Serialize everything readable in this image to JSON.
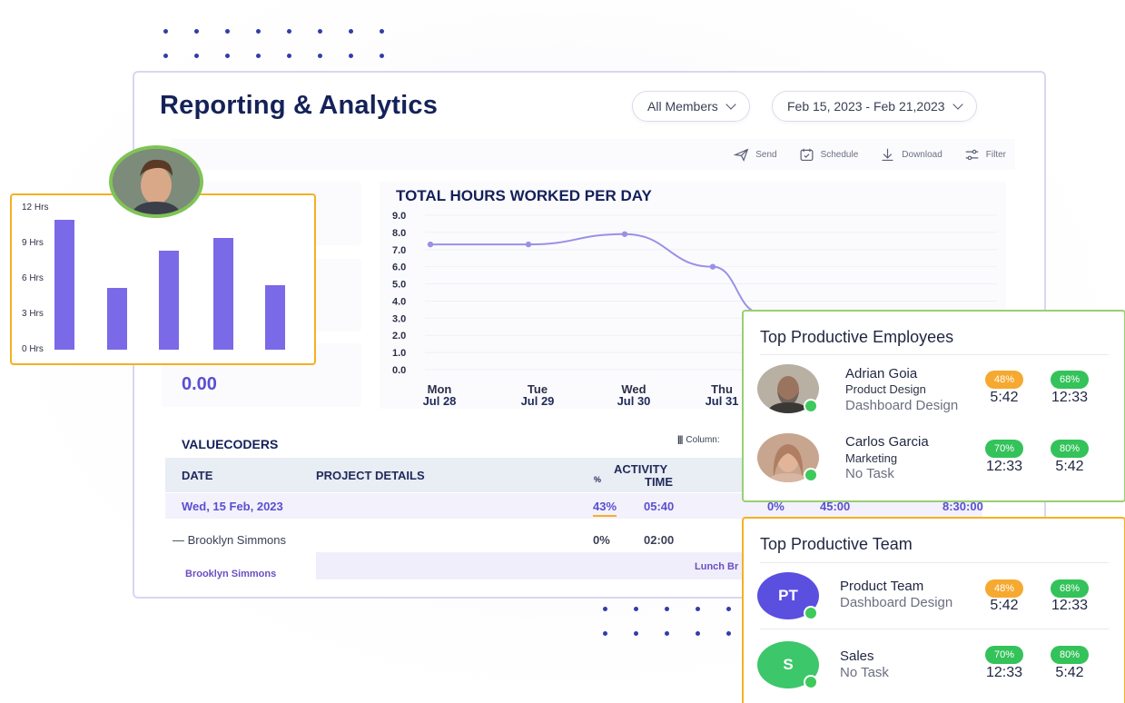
{
  "page": {
    "title": "Reporting & Analytics",
    "members_filter": "All Members",
    "date_range": "Feb 15, 2023 - Feb 21,2023"
  },
  "toolbar": {
    "send": "Send",
    "schedule": "Schedule",
    "download": "Download",
    "filter": "Filter"
  },
  "left_stat": {
    "value": "0.00"
  },
  "chart_data": [
    {
      "type": "line",
      "title": "TOTAL HOURS WORKED PER DAY",
      "categories": [
        [
          "Mon",
          "Jul 28"
        ],
        [
          "Tue",
          "Jul 29"
        ],
        [
          "Wed",
          "Jul 30"
        ],
        [
          "Thu",
          "Jul 31"
        ]
      ],
      "y_ticks": [
        "9.0",
        "8.0",
        "7.0",
        "6.0",
        "5.0",
        "4.0",
        "3.0",
        "2.0",
        "1.0",
        "0.0"
      ],
      "ylim": [
        0,
        9
      ],
      "values": [
        7.3,
        7.3,
        7.9,
        6.0
      ],
      "trailing_value": 3.3,
      "color": "#9a90e8"
    },
    {
      "type": "bar",
      "y_ticks": [
        "12 Hrs",
        "9 Hrs",
        "6 Hrs",
        "3 Hrs",
        "0 Hrs"
      ],
      "ylim": [
        0,
        12
      ],
      "values": [
        11.0,
        5.2,
        8.4,
        9.5,
        5.5
      ],
      "color": "#7a6ae8"
    }
  ],
  "table": {
    "section_title": "VALUECODERS",
    "column_button": "Column:",
    "headers": {
      "date": "DATE",
      "project": "PROJECT DETAILS",
      "activity": "ACTIVITY",
      "percent": "%",
      "time": "TIME"
    },
    "rows": [
      {
        "date": "Wed, 15 Feb, 2023",
        "percent": "43%",
        "time": "05:40",
        "pct2": "0%",
        "t2": "45:00",
        "t3": "8:30:00"
      },
      {
        "name": "— Brooklyn Simmons",
        "percent": "0%",
        "time": "02:00"
      }
    ],
    "sub_label": "Brooklyn Simmons",
    "lunch_label": "Lunch Br"
  },
  "top_employees": {
    "title": "Top Productive Employees",
    "items": [
      {
        "name": "Adrian Goia",
        "role": "Product Design",
        "task": "Dashboard Design",
        "p1": "48%",
        "p2": "68%",
        "t1": "5:42",
        "t2": "12:33"
      },
      {
        "name": "Carlos Garcia",
        "role": "Marketing",
        "task": "No Task",
        "p1": "70%",
        "p2": "80%",
        "t1": "12:33",
        "t2": "5:42"
      }
    ]
  },
  "top_team": {
    "title": "Top Productive Team",
    "items": [
      {
        "initials": "PT",
        "name": "Product Team",
        "task": "Dashboard Design",
        "p1": "48%",
        "p2": "68%",
        "t1": "5:42",
        "t2": "12:33",
        "color": "#5b4fe0"
      },
      {
        "initials": "S",
        "name": "Sales",
        "task": "No Task",
        "p1": "70%",
        "p2": "80%",
        "t1": "12:33",
        "t2": "5:42",
        "color": "#3cc76a"
      }
    ]
  },
  "colors": {
    "accent": "#5a4fd1",
    "orange_border": "#f4b024",
    "green_border": "#98d071",
    "navy": "#152259"
  }
}
